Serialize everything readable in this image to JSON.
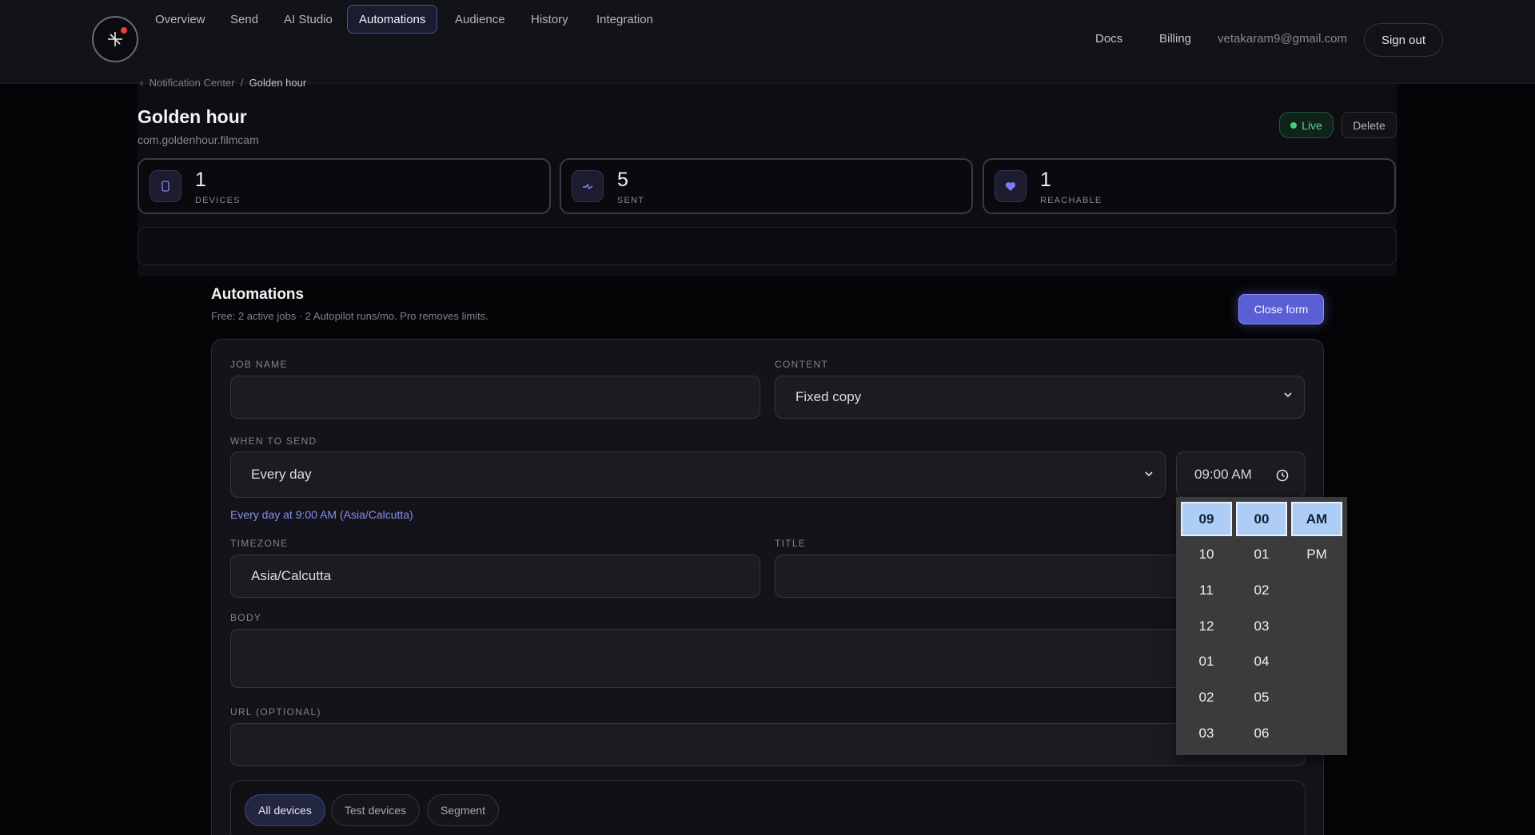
{
  "header": {
    "nav": [
      "Docs",
      "Billing"
    ],
    "email": "vetakaram9@gmail.com",
    "sign_out": "Sign out"
  },
  "breadcrumb": {
    "parent": "Notification Center",
    "separator": "/",
    "current": "Golden hour"
  },
  "app": {
    "title": "Golden hour",
    "bundle_id": "com.goldenhour.filmcam",
    "status": "Live",
    "delete": "Delete"
  },
  "stats": [
    {
      "value": "1",
      "label": "DEVICES",
      "icon": "phone-icon"
    },
    {
      "value": "5",
      "label": "SENT",
      "icon": "pulse-icon"
    },
    {
      "value": "1",
      "label": "REACHABLE",
      "icon": "heart-icon"
    }
  ],
  "tabs": [
    "Overview",
    "Send",
    "AI Studio",
    "Automations",
    "Audience",
    "History",
    "Integration"
  ],
  "active_tab": "Automations",
  "automations": {
    "title": "Automations",
    "subtitle": "Free: 2 active jobs · 2 Autopilot runs/mo. Pro removes limits.",
    "close_form": "Close form"
  },
  "form": {
    "job_name_label": "JOB NAME",
    "job_name_value": "",
    "content_label": "CONTENT",
    "content_value": "Fixed copy",
    "when_label": "WHEN TO SEND",
    "when_value": "Every day",
    "time_value": "09:00 AM",
    "schedule_helper": "Every day at 9:00 AM (Asia/Calcutta)",
    "timezone_label": "TIMEZONE",
    "timezone_value": "Asia/Calcutta",
    "title_label": "TITLE",
    "title_value": "",
    "body_label": "BODY",
    "body_value": "",
    "url_label": "URL (OPTIONAL)",
    "url_value": ""
  },
  "time_picker": {
    "hours": [
      "09",
      "10",
      "11",
      "12",
      "01",
      "02",
      "03"
    ],
    "minutes": [
      "00",
      "01",
      "02",
      "03",
      "04",
      "05",
      "06"
    ],
    "periods": [
      "AM",
      "PM"
    ],
    "selected": {
      "hour": "09",
      "minute": "00",
      "period": "AM"
    }
  },
  "audience": {
    "options": [
      "All devices",
      "Test devices",
      "Segment"
    ],
    "selected": "All devices"
  },
  "colors": {
    "accent": "#5b5fd6",
    "live": "#3ed07f",
    "picker_selected": "#aecdf4",
    "brand_dot": "#ef3b3b"
  }
}
